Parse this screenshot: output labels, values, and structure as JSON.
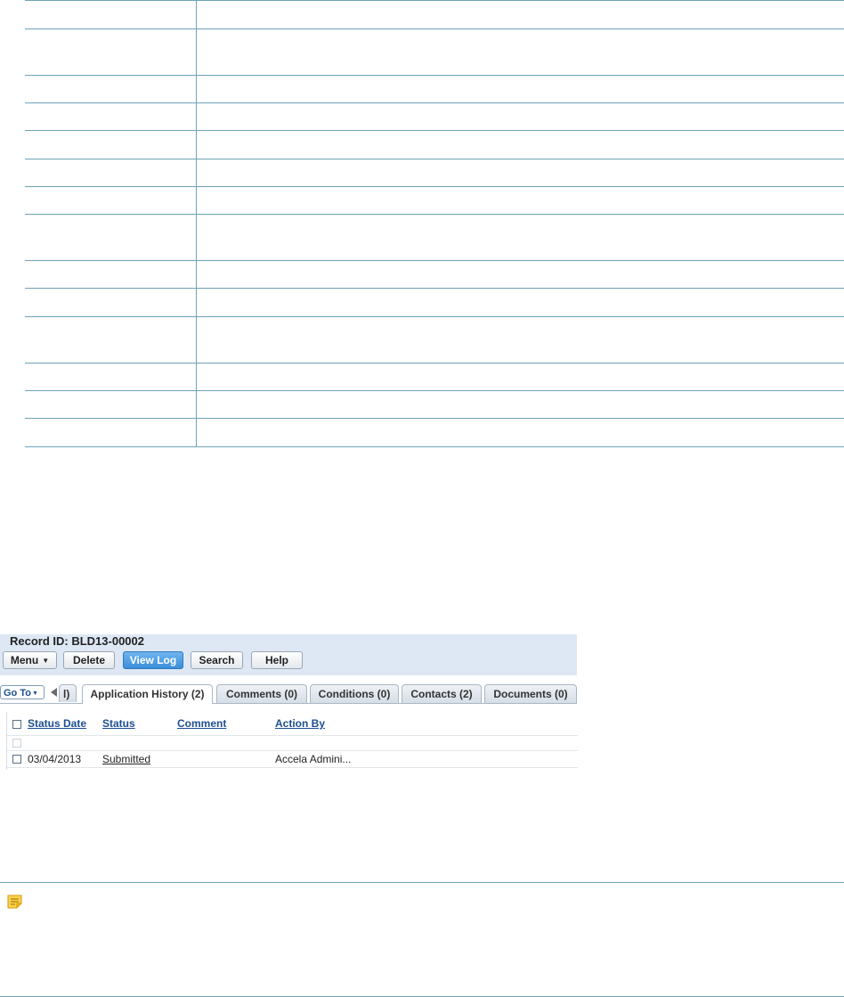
{
  "record": {
    "label": "Record ID: BLD13-00002"
  },
  "toolbar": {
    "menu": "Menu",
    "delete": "Delete",
    "view_log": "View Log",
    "search": "Search",
    "help": "Help"
  },
  "tabs": {
    "goto": "Go To",
    "partial": "l)",
    "items": [
      {
        "label": "Application History (2)"
      },
      {
        "label": "Comments (0)"
      },
      {
        "label": "Conditions (0)"
      },
      {
        "label": "Contacts (2)"
      },
      {
        "label": "Documents (0)"
      }
    ],
    "active_index": 0
  },
  "grid": {
    "columns": [
      "Status Date",
      "Status",
      "Comment",
      "Action By"
    ],
    "rows": [
      {
        "status_date": "03/04/2013",
        "status": "Submitted",
        "comment": "",
        "action_by": "Accela Admini..."
      }
    ]
  },
  "icons": {
    "note": "note-icon",
    "menu_caret": "chevron-down-icon",
    "scroll_left": "arrow-left-icon"
  },
  "colors": {
    "table_rule": "#6ea3b8",
    "header_bg": "#dde8f4",
    "primary_button": "#3b8fda",
    "link": "#1d4f91",
    "note_icon": "#f2b41b"
  }
}
